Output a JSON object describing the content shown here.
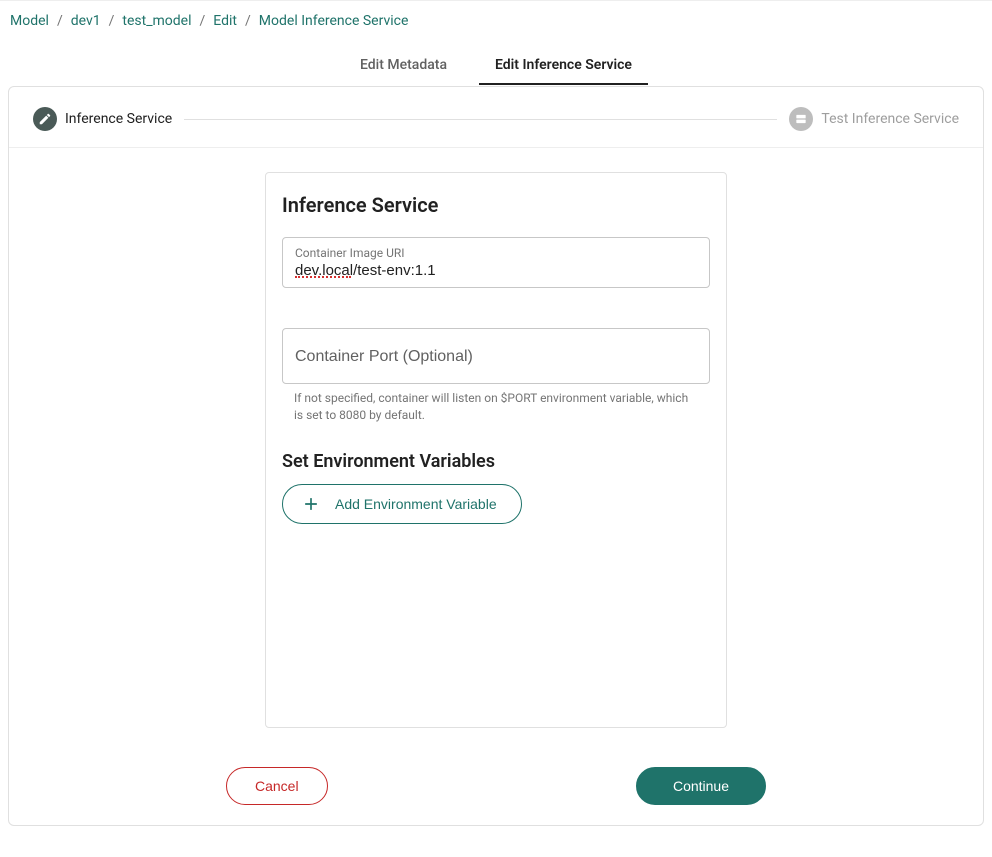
{
  "breadcrumb": {
    "items": [
      "Model",
      "dev1",
      "test_model",
      "Edit",
      "Model Inference Service"
    ]
  },
  "tabs": {
    "metadata": "Edit Metadata",
    "inference": "Edit Inference Service"
  },
  "stepper": {
    "step1_label": "Inference Service",
    "step2_label": "Test Inference Service"
  },
  "form": {
    "title": "Inference Service",
    "uri_label": "Container Image URI",
    "uri_value": "dev.local/test-env:1.1",
    "port_placeholder": "Container Port (Optional)",
    "port_helper": "If not specified, container will listen on $PORT environment variable, which is set to 8080 by default.",
    "env_title": "Set Environment Variables",
    "add_env_label": "Add Environment Variable"
  },
  "footer": {
    "cancel": "Cancel",
    "continue": "Continue"
  }
}
